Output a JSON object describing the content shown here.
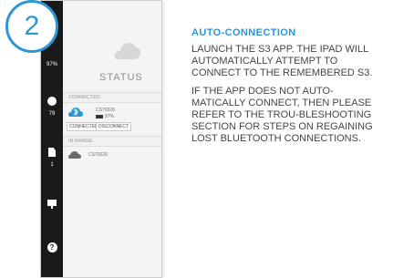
{
  "step_number": "2",
  "accent_color": "#2d97d3",
  "app_screen": {
    "rail": [
      {
        "icon": "circle-icon",
        "label": "79"
      },
      {
        "icon": "document-icon",
        "label": "1"
      },
      {
        "icon": "presentation-icon",
        "label": ""
      },
      {
        "icon": "help-icon",
        "label": "?"
      }
    ],
    "rail_top_value": "97%",
    "status_title": "STATUS",
    "connected_header": "CONNECTED",
    "connected_device": {
      "name": "CS70226",
      "battery": "97%"
    },
    "connected_label": "CONNECTED",
    "disconnect_label": "DISCONNECT",
    "in_range_header": "IN RANGE",
    "in_range_device": {
      "name": "CS70226"
    }
  },
  "instructions": {
    "heading": "AUTO-CONNECTION",
    "paragraphs": [
      "LAUNCH THE S3 APP. THE iPAD WILL AUTOMATICALLY ATTEMPT TO CONNECT TO THE REMEMBERED S3.",
      "IF THE APP DOES NOT AUTO-MATICALLY CONNECT, THEN PLEASE REFER TO THE TROU-BLESHOOTING SECTION FOR STEPS ON REGAINING LOST BLUETOOTH CONNECTIONS."
    ]
  }
}
